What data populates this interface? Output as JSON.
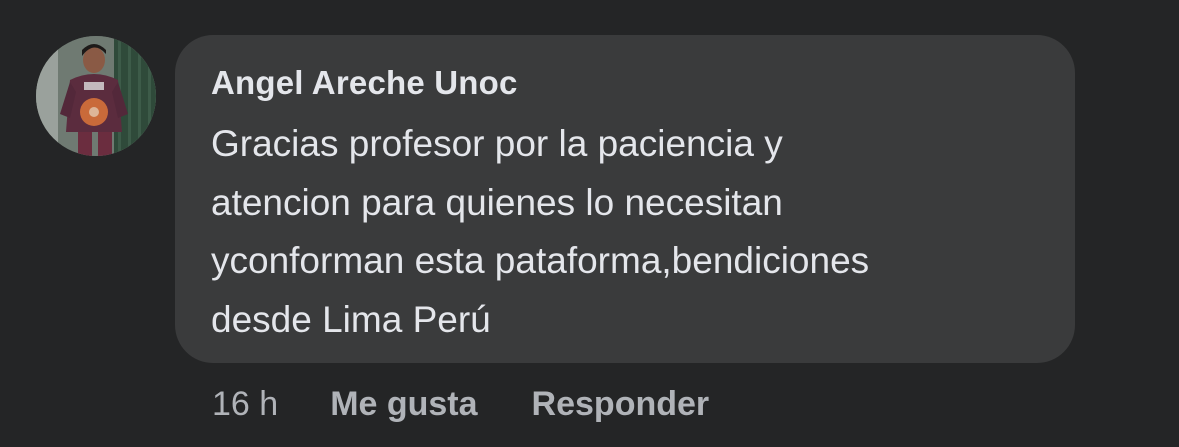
{
  "comment": {
    "author": "Angel Areche Unoc",
    "text": "Gracias profesor por la paciencia y\natencion para quienes lo necesitan\nyconforman esta pataforma,bendiciones\ndesde Lima Perú",
    "time": "16 h",
    "like_label": "Me gusta",
    "reply_label": "Responder"
  },
  "colors": {
    "background": "#242526",
    "bubble": "#3a3b3c",
    "primary_text": "#e4e6eb",
    "secondary_text": "#b0b3b8"
  }
}
